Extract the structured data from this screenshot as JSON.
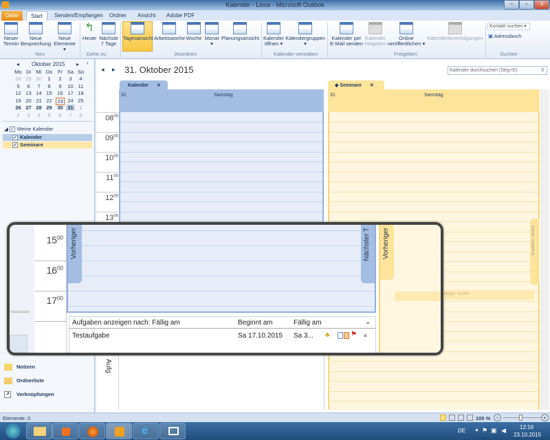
{
  "window": {
    "title": "Kalender - Linux - Microsoft Outlook",
    "min": "–",
    "max": "▫",
    "close": "X"
  },
  "tabs": [
    "Datei",
    "Start",
    "Senden/Empfangen",
    "Ordner",
    "Ansicht",
    "Adobe PDF"
  ],
  "ribbon": {
    "buttons": [
      {
        "label": "Neuer Termin",
        "icon": "new-appointment-icon"
      },
      {
        "label": "Neue Besprechung",
        "icon": "new-meeting-icon"
      },
      {
        "label": "Neue Elemente ▾",
        "icon": "new-items-icon"
      },
      {
        "label": "Heute",
        "icon": "today-icon"
      },
      {
        "label": "Nächste 7 Tage",
        "icon": "next-7-days-icon"
      },
      {
        "label": "Tagesansicht",
        "icon": "day-view-icon"
      },
      {
        "label": "Arbeitswoche",
        "icon": "work-week-icon"
      },
      {
        "label": "Woche",
        "icon": "week-icon"
      },
      {
        "label": "Monat ▾",
        "icon": "month-icon"
      },
      {
        "label": "Planungsansicht",
        "icon": "schedule-view-icon"
      },
      {
        "label": "Kalender öffnen ▾",
        "icon": "open-calendar-icon"
      },
      {
        "label": "Kalendergruppen ▾",
        "icon": "calendar-groups-icon"
      },
      {
        "label": "Kalender per E-Mail senden",
        "icon": "email-calendar-icon"
      },
      {
        "label": "Kalender freigeben",
        "icon": "share-calendar-icon"
      },
      {
        "label": "Online veröffentlichen ▾",
        "icon": "publish-online-icon"
      },
      {
        "label": "Kalenderberechtigungen",
        "icon": "calendar-permissions-icon"
      }
    ],
    "groups": [
      "Neu",
      "Gehe zu",
      "Anordnen",
      "Kalender verwalten",
      "Freigeben",
      "Suchen"
    ],
    "contact_search": "Kontakt suchen",
    "address_book": "Adressbuch"
  },
  "minical": {
    "month": "Oktober 2015",
    "weekdays": [
      "Mo",
      "Di",
      "Mi",
      "Do",
      "Fr",
      "Sa",
      "So"
    ],
    "weeks": [
      [
        "28",
        "29",
        "30",
        "1",
        "2",
        "3",
        "4"
      ],
      [
        "5",
        "6",
        "7",
        "8",
        "9",
        "10",
        "11"
      ],
      [
        "12",
        "13",
        "14",
        "15",
        "16",
        "17",
        "18"
      ],
      [
        "19",
        "20",
        "21",
        "22",
        "23",
        "24",
        "25"
      ],
      [
        "26",
        "27",
        "28",
        "29",
        "30",
        "31",
        "1"
      ],
      [
        "2",
        "3",
        "4",
        "5",
        "6",
        "7",
        "8"
      ]
    ],
    "today": "23",
    "selected": "31"
  },
  "calendars": {
    "group": "Meine Kalender",
    "items": [
      "Kalender",
      "Seminare"
    ]
  },
  "nav_bottom": [
    "Notizen",
    "Ordnerliste",
    "Verknüpfungen"
  ],
  "main": {
    "date": "31. Oktober 2015",
    "search_placeholder": "Kalender durchsuchen (Strg+E)",
    "columns": [
      {
        "tab": "Kalender",
        "day": "31",
        "weekday": "Samstag",
        "color": "#a3bde3"
      },
      {
        "tab": "Seminare",
        "day": "31",
        "weekday": "Samstag",
        "color": "#fde49b"
      }
    ],
    "hours": [
      "08",
      "09",
      "10",
      "11",
      "12",
      "13"
    ],
    "minutes": "00",
    "next_label": "Nächster Termin",
    "prev_label": "Vorheriger Termin",
    "tasks_label": "Aufg"
  },
  "magnifier": {
    "hours": [
      "15",
      "16",
      "17"
    ],
    "prev": "Vorheriger",
    "next": "Nächster T",
    "tasks_header": {
      "sort": "Aufgaben anzeigen nach: Fällig am",
      "start": "Beginnt am",
      "due": "Fällig am"
    },
    "task": {
      "name": "Testaufgabe",
      "start": "Sa 17.10.2015",
      "due": "Sa 3..."
    }
  },
  "status": {
    "items": "Elemente: 0",
    "zoom": "100 %"
  },
  "taskbar": {
    "lang": "DE",
    "time": "12:16",
    "date": "23.10.2015"
  }
}
